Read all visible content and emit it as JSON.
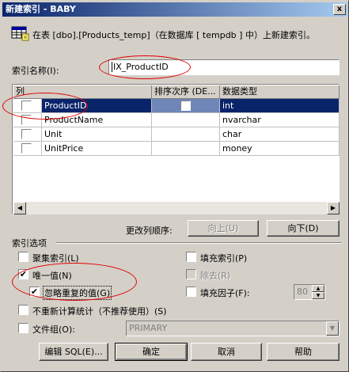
{
  "window": {
    "title": "新建索引 - BABY",
    "close_glyph": "x",
    "description": "在表 [dbo].[Products_temp]（在数据库 [ tempdb ] 中）上新建索引。"
  },
  "index_name": {
    "label": "索引名称(I):",
    "value": "IX_ProductID"
  },
  "columns_grid": {
    "headers": [
      "列",
      "排序次序 (DE...",
      "数据类型"
    ],
    "rows": [
      {
        "checked": "✔",
        "name": "ProductID",
        "sort": "",
        "type": "int"
      },
      {
        "checked": "",
        "name": "ProductName",
        "sort": "",
        "type": "nvarchar"
      },
      {
        "checked": "",
        "name": "Unit",
        "sort": "",
        "type": "char"
      },
      {
        "checked": "",
        "name": "UnitPrice",
        "sort": "",
        "type": "money"
      }
    ]
  },
  "reorder": {
    "label": "更改列顺序:",
    "up_label": "向上(U)",
    "down_label": "向下(D)"
  },
  "options": {
    "group_label": "索引选项",
    "clustered": {
      "label": "聚集索引(L)",
      "checked": ""
    },
    "pad_index": {
      "label": "填充索引(P)",
      "checked": ""
    },
    "unique": {
      "label": "唯一值(N)",
      "checked": "✔"
    },
    "drop_existing": {
      "label": "除去(R)",
      "checked": ""
    },
    "ignore_dup": {
      "label": "忽略重复的值(G)",
      "checked": "✔"
    },
    "fill_factor": {
      "label": "填充因子(F):",
      "checked": "",
      "value": "80"
    },
    "no_recompute": {
      "label": "不重新计算统计（不推荐使用）(S)",
      "checked": ""
    },
    "filegroup": {
      "label": "文件组(O):",
      "checked": "",
      "value": "PRIMARY"
    }
  },
  "buttons": {
    "edit_sql": "编辑 SQL(E)...",
    "ok": "确定",
    "cancel": "取消",
    "help": "帮助"
  },
  "colors": {
    "selection": "#0a246a",
    "annotation_red": "#e00000"
  }
}
